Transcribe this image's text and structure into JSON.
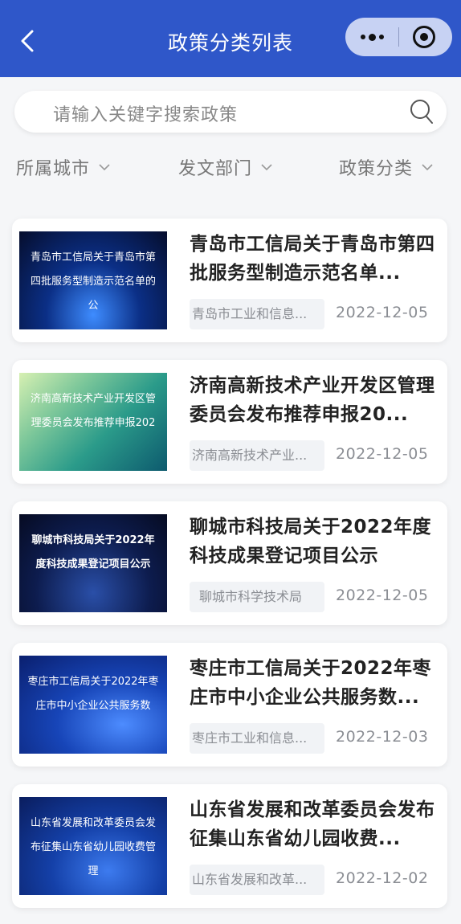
{
  "header": {
    "title": "政策分类列表"
  },
  "search": {
    "placeholder": "请输入关键字搜索政策"
  },
  "filters": [
    {
      "label": "所属城市"
    },
    {
      "label": "发文部门"
    },
    {
      "label": "政策分类"
    }
  ],
  "policies": [
    {
      "thumb_text": "青岛市工信局关于青岛市第四批服务型制造示范名单的公",
      "title": "青岛市工信局关于青岛市第四批服务型制造示范名单...",
      "department": "青岛市工业和信息...",
      "date": "2022-12-05",
      "theme": "blue"
    },
    {
      "thumb_text": "济南高新技术产业开发区管理委员会发布推荐申报202",
      "title": "济南高新技术产业开发区管理委员会发布推荐申报20...",
      "department": "济南高新技术产业...",
      "date": "2022-12-05",
      "theme": "green"
    },
    {
      "thumb_text": "聊城市科技局关于2022年度科技成果登记项目公示",
      "title": "聊城市科技局关于2022年度科技成果登记项目公示",
      "department": "聊城市科学技术局",
      "date": "2022-12-05",
      "theme": "navy"
    },
    {
      "thumb_text": "枣庄市工信局关于2022年枣庄市中小企业公共服务数",
      "title": "枣庄市工信局关于2022年枣庄市中小企业公共服务数...",
      "department": "枣庄市工业和信息...",
      "date": "2022-12-03",
      "theme": "blue2"
    },
    {
      "thumb_text": "山东省发展和改革委员会发布征集山东省幼儿园收费管理",
      "title": "山东省发展和改革委员会发布征集山东省幼儿园收费...",
      "department": "山东省发展和改革...",
      "date": "2022-12-02",
      "theme": "blue3"
    }
  ],
  "colors": {
    "header_bg": "#2f57c9",
    "page_bg": "#f5f6f8"
  }
}
